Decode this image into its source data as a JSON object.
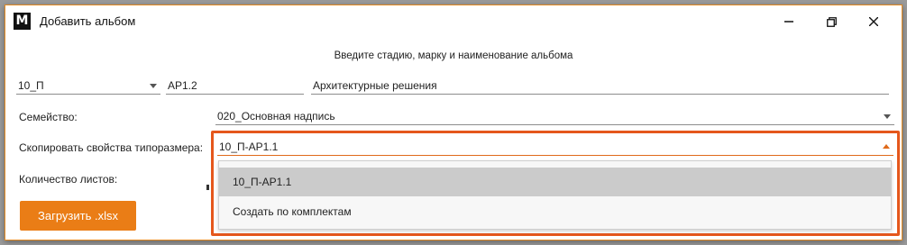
{
  "window": {
    "app_icon_text": "M",
    "title": "Добавить альбом",
    "accent_color": "#ea7d16",
    "highlight_color": "#e5571c"
  },
  "subtitle": "Введите стадию, марку и наименование альбома",
  "stage": {
    "value": "10_П"
  },
  "mark": {
    "value": "АР1.2"
  },
  "name": {
    "value": "Архитектурные решения"
  },
  "family": {
    "label": "Семейство:",
    "value": "020_Основная надпись"
  },
  "copy_props": {
    "label": "Скопировать свойства типоразмера:",
    "value": "10_П-АР1.1",
    "options": [
      "10_П-АР1.1",
      "Создать по комплектам"
    ]
  },
  "sheets": {
    "label": "Количество листов:"
  },
  "load_button": {
    "label": "Загрузить .xlsx"
  }
}
